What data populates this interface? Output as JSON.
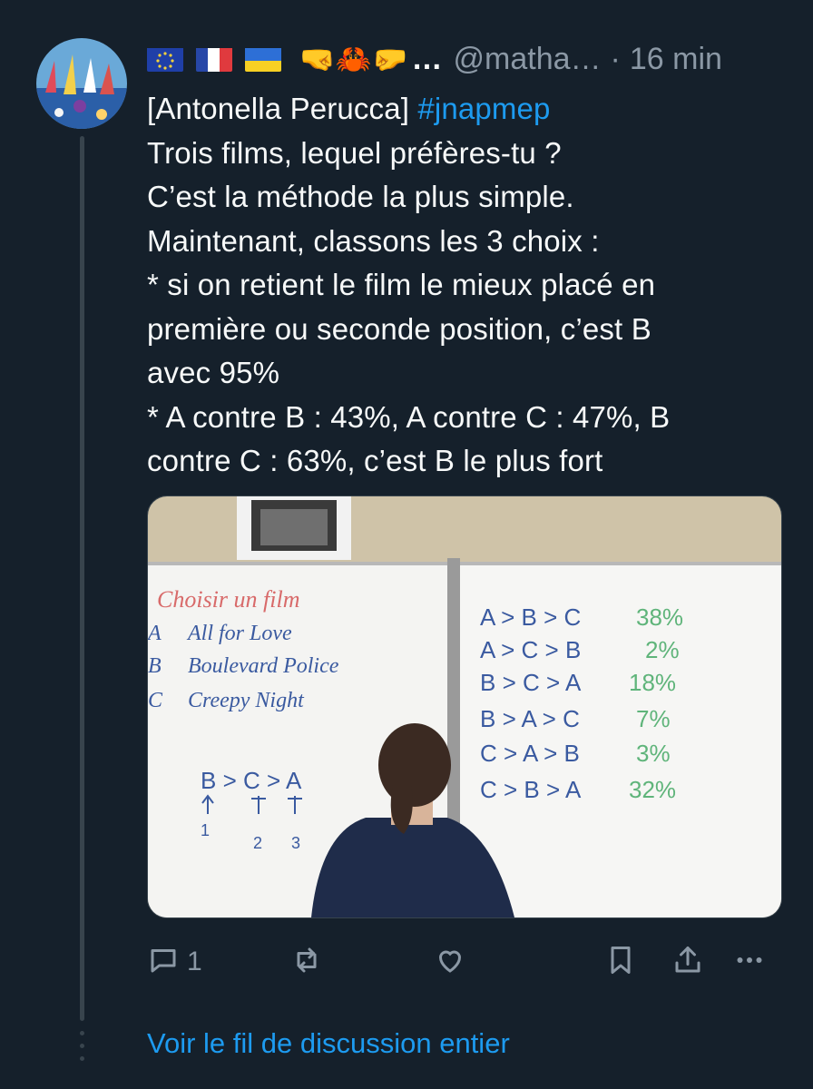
{
  "tweet": {
    "emoji_run": "🤜🦀🤛",
    "ellipsis": "…",
    "handle": "@matha…",
    "dot": "·",
    "time": "16 min",
    "lines": [
      {
        "prefix": "[Antonella Perucca] ",
        "hashtag": "#jnapmep"
      },
      {
        "text": "Trois films, lequel préfères-tu ?"
      },
      {
        "text": "C’est la méthode la plus simple."
      },
      {
        "text": "Maintenant, classons les 3 choix :"
      },
      {
        "text": "* si on retient le film le mieux placé en"
      },
      {
        "text": "première ou seconde position, c’est B"
      },
      {
        "text": "avec 95%"
      },
      {
        "text": "* A contre B : 43%, A contre C : 47%, B"
      },
      {
        "text": "contre C : 63%, c’est B le plus fort"
      }
    ]
  },
  "board": {
    "left_title": "Choisir un film",
    "films": [
      {
        "letter": "A",
        "title": "All for Love"
      },
      {
        "letter": "B",
        "title": "Boulevard Police"
      },
      {
        "letter": "C",
        "title": "Creepy Night"
      }
    ],
    "ranking": "B > C > A",
    "ranking_positions": [
      "1",
      "2",
      "3"
    ],
    "results": [
      {
        "order": "A > B > C",
        "pct": "38%"
      },
      {
        "order": "A > C > B",
        "pct": "2%"
      },
      {
        "order": "B > C > A",
        "pct": "18%"
      },
      {
        "order": "B > A > C",
        "pct": "7%"
      },
      {
        "order": "C > A > B",
        "pct": "3%"
      },
      {
        "order": "C > B > A",
        "pct": "32%"
      }
    ]
  },
  "actions": {
    "reply_count": "1",
    "icons": [
      "reply-icon",
      "retweet-icon",
      "like-icon",
      "bookmark-icon",
      "share-icon",
      "more-icon"
    ]
  },
  "thread_link": "Voir le fil de discussion entier",
  "colors": {
    "background": "#15202b",
    "text": "#f7f9f9",
    "muted": "#8b98a5",
    "accent": "#1d9bf0",
    "thread_line": "#38444d",
    "board_red": "#d86a6a",
    "board_green": "#5fb47a",
    "board_blue": "#3a5aa0"
  }
}
